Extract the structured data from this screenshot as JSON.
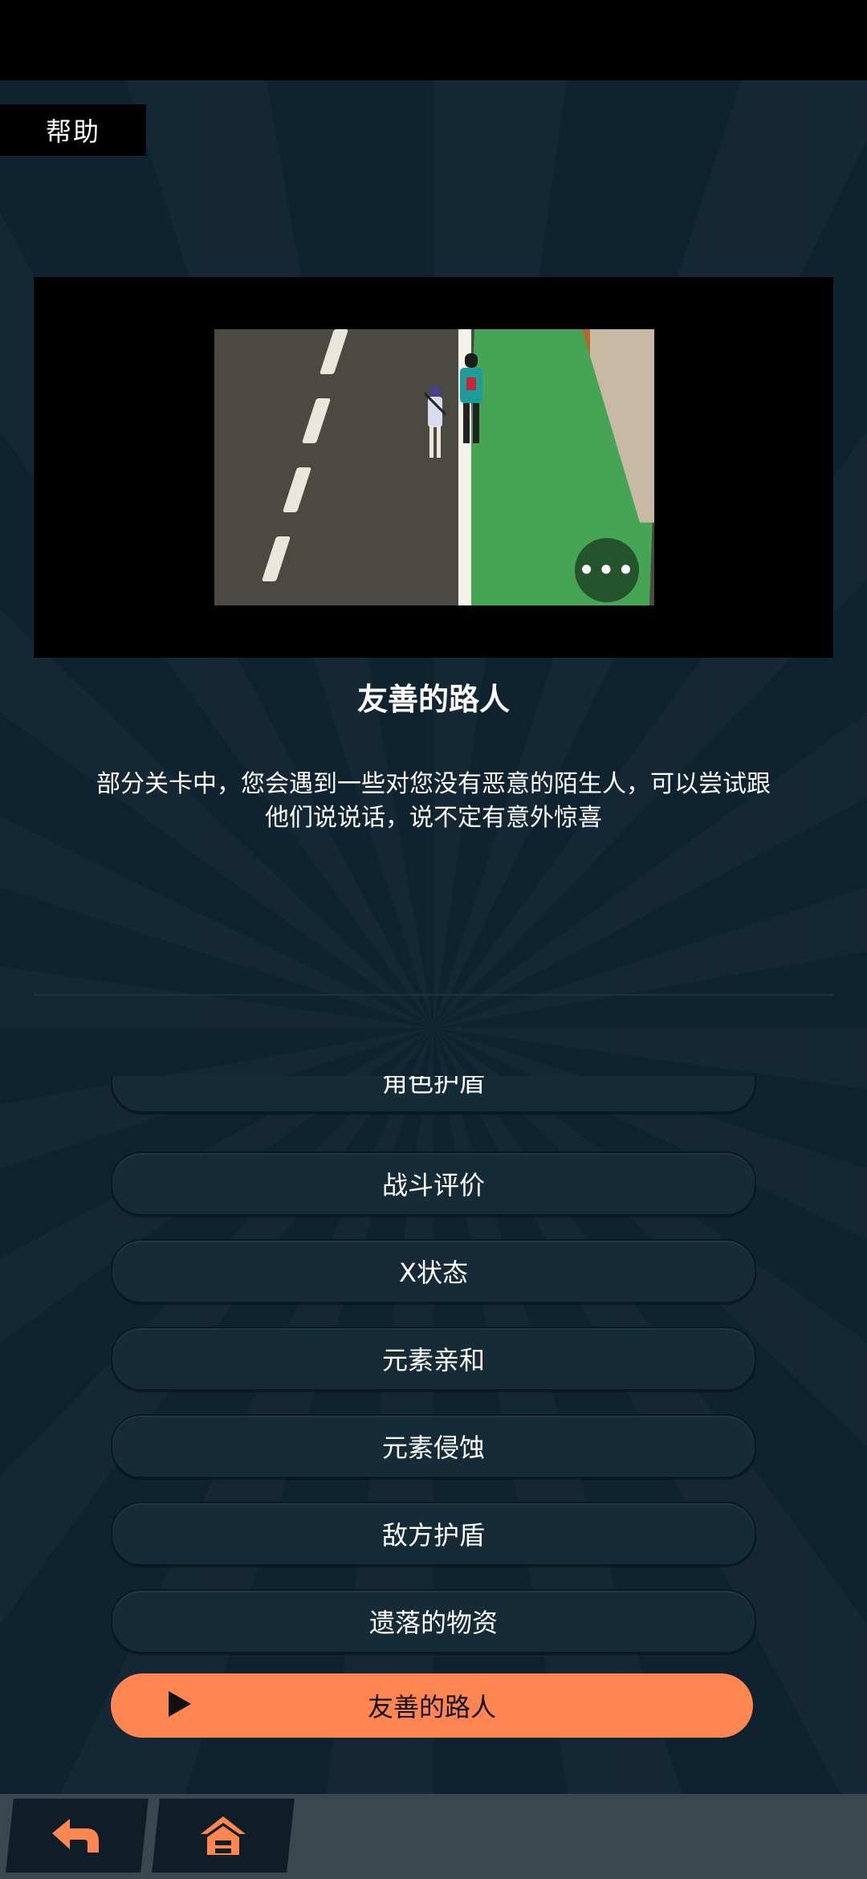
{
  "header": {
    "help_label": "帮助"
  },
  "detail": {
    "title": "友善的路人",
    "description_line1": "部分关卡中，您会遇到一些对您没有恶意的陌生人，可以尝试跟",
    "description_line2": "他们说说话，说不定有意外惊喜",
    "more_label": "•••"
  },
  "menu": {
    "items": [
      {
        "label": "角色护盾"
      },
      {
        "label": "战斗评价"
      },
      {
        "label": "X状态"
      },
      {
        "label": "元素亲和"
      },
      {
        "label": "元素侵蚀"
      },
      {
        "label": "敌方护盾"
      },
      {
        "label": "遗落的物资"
      },
      {
        "label": "友善的路人",
        "selected": true
      }
    ]
  },
  "bottom_nav": {
    "back_icon": "back-arrow-icon",
    "home_icon": "home-icon"
  },
  "colors": {
    "accent": "#ff8651",
    "background": "#0f2230",
    "item": "#162b38",
    "bottom_bar": "#39484f"
  }
}
